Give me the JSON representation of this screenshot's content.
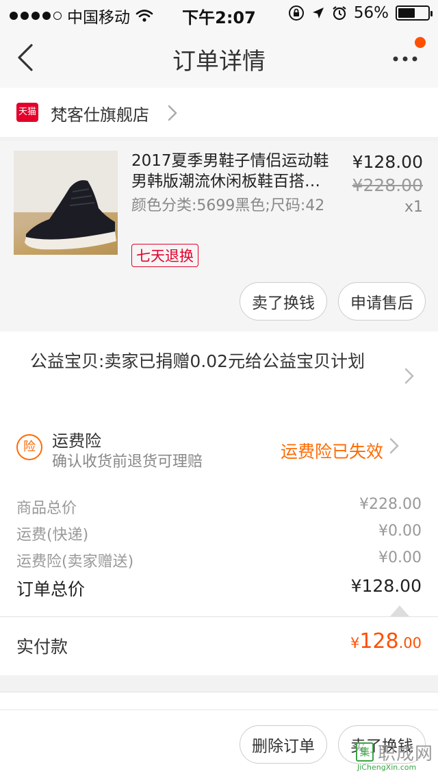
{
  "status_bar": {
    "carrier": "中国移动",
    "time": "下午2:07",
    "battery": "56%",
    "battery_level": 0.56,
    "signal_bars": 4
  },
  "nav": {
    "title": "订单详情",
    "back_icon": "chevron-left-icon",
    "more_icon": "more-dots-icon",
    "notification_color": "#ff5000"
  },
  "shop": {
    "badge": "天猫",
    "name": "梵客仕旗舰店"
  },
  "product": {
    "title": "2017夏季男鞋子情侣运动鞋男韩版潮流休闲板鞋百搭…",
    "spec": "颜色分类:5699黑色;尺码:42",
    "tag": "七天退换",
    "price": "¥128.00",
    "original_price": "¥228.00",
    "quantity": "x1",
    "actions": {
      "sell_exchange": "卖了换钱",
      "after_sales": "申请售后"
    }
  },
  "charity": {
    "text": "公益宝贝:卖家已捐赠0.02元给公益宝贝计划"
  },
  "insurance": {
    "icon": "险",
    "title": "运费险",
    "subtitle": "确认收货前退货可理赔",
    "status": "运费险已失效"
  },
  "totals": {
    "rows": [
      {
        "label": "商品总价",
        "value": "¥228.00"
      },
      {
        "label": "运费(快递)",
        "value": "¥0.00"
      },
      {
        "label": "运费险(卖家赠送)",
        "value": "¥0.00"
      }
    ],
    "order_total": {
      "label": "订单总价",
      "value": "¥128.00"
    }
  },
  "paid": {
    "label": "实付款",
    "currency": "¥",
    "integer": "128",
    "decimal": ".00"
  },
  "bottom": {
    "delete_order": "删除订单",
    "sell_exchange": "卖了换钱"
  },
  "watermark": {
    "box": "集",
    "cn": "职成网",
    "en": "JiChengXin.com"
  },
  "colors": {
    "accent": "#ff5000",
    "tmall_red": "#e4002b"
  }
}
